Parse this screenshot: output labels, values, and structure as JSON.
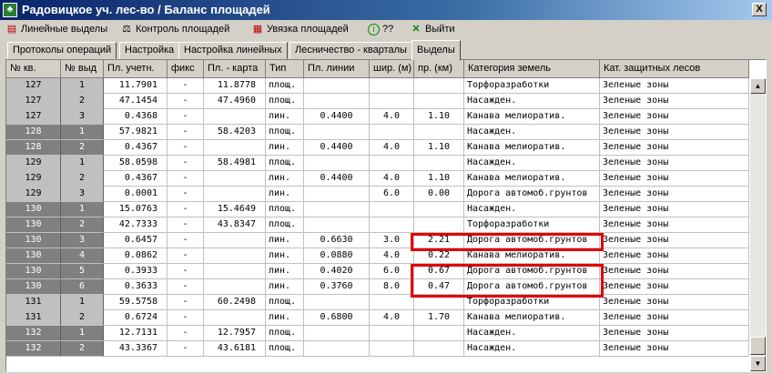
{
  "window": {
    "title": "Радовицкое уч. лес-во / Баланс площадей",
    "close_label": "X"
  },
  "toolbar": {
    "items": [
      {
        "label": "Линейные выделы",
        "icon": "document-icon"
      },
      {
        "label": "Контроль площадей",
        "icon": "scales-icon"
      },
      {
        "label": "Увязка площадей",
        "icon": "calculator-icon"
      },
      {
        "label": "??",
        "icon": "info-icon"
      },
      {
        "label": "Выйти",
        "icon": "exit-x-icon"
      }
    ]
  },
  "tabs": [
    {
      "label": "Протоколы операций",
      "active": false
    },
    {
      "label": "Настройка",
      "active": false
    },
    {
      "label": "Настройка линейных",
      "active": false
    },
    {
      "label": "Лесничество - кварталы",
      "active": false
    },
    {
      "label": "Выделы",
      "active": true
    }
  ],
  "table": {
    "columns": [
      "№ кв.",
      "№ выд",
      "Пл. учетн.",
      "фикс",
      "Пл. - карта",
      "Тип",
      "Пл. линии",
      "шир. (м)",
      "пр. (км)",
      "Категория земель",
      "Кат. защитных лесов"
    ],
    "rows": [
      {
        "kv": "127",
        "vyd": "1",
        "pl": "11.7901",
        "fix": "-",
        "karta": "11.8778",
        "tip": "площ.",
        "lin": "",
        "shir": "",
        "pr": "",
        "kat": "Торфоразработки",
        "zash": "Зеленые зоны"
      },
      {
        "kv": "127",
        "vyd": "2",
        "pl": "47.1454",
        "fix": "-",
        "karta": "47.4960",
        "tip": "площ.",
        "lin": "",
        "shir": "",
        "pr": "",
        "kat": "Насажден.",
        "zash": "Зеленые зоны"
      },
      {
        "kv": "127",
        "vyd": "3",
        "pl": "0.4368",
        "fix": "-",
        "karta": "",
        "tip": "лин.",
        "lin": "0.4400",
        "shir": "4.0",
        "pr": "1.10",
        "kat": "Канава мелиоратив.",
        "zash": "Зеленые зоны"
      },
      {
        "kv": "128",
        "vyd": "1",
        "pl": "57.9821",
        "fix": "-",
        "karta": "58.4203",
        "tip": "площ.",
        "lin": "",
        "shir": "",
        "pr": "",
        "kat": "Насажден.",
        "zash": "Зеленые зоны"
      },
      {
        "kv": "128",
        "vyd": "2",
        "pl": "0.4367",
        "fix": "-",
        "karta": "",
        "tip": "лин.",
        "lin": "0.4400",
        "shir": "4.0",
        "pr": "1.10",
        "kat": "Канава мелиоратив.",
        "zash": "Зеленые зоны"
      },
      {
        "kv": "129",
        "vyd": "1",
        "pl": "58.0598",
        "fix": "-",
        "karta": "58.4981",
        "tip": "площ.",
        "lin": "",
        "shir": "",
        "pr": "",
        "kat": "Насажден.",
        "zash": "Зеленые зоны"
      },
      {
        "kv": "129",
        "vyd": "2",
        "pl": "0.4367",
        "fix": "-",
        "karta": "",
        "tip": "лин.",
        "lin": "0.4400",
        "shir": "4.0",
        "pr": "1.10",
        "kat": "Канава мелиоратив.",
        "zash": "Зеленые зоны"
      },
      {
        "kv": "129",
        "vyd": "3",
        "pl": "0.0001",
        "fix": "-",
        "karta": "",
        "tip": "лин.",
        "lin": "",
        "shir": "6.0",
        "pr": "0.00",
        "kat": "Дорога автомоб.грунтов",
        "zash": "Зеленые зоны"
      },
      {
        "kv": "130",
        "vyd": "1",
        "pl": "15.0763",
        "fix": "-",
        "karta": "15.4649",
        "tip": "площ.",
        "lin": "",
        "shir": "",
        "pr": "",
        "kat": "Насажден.",
        "zash": "Зеленые зоны"
      },
      {
        "kv": "130",
        "vyd": "2",
        "pl": "42.7333",
        "fix": "-",
        "karta": "43.8347",
        "tip": "площ.",
        "lin": "",
        "shir": "",
        "pr": "",
        "kat": "Торфоразработки",
        "zash": "Зеленые зоны"
      },
      {
        "kv": "130",
        "vyd": "3",
        "pl": "0.6457",
        "fix": "-",
        "karta": "",
        "tip": "лин.",
        "lin": "0.6630",
        "shir": "3.0",
        "pr": "2.21",
        "kat": "Дорога автомоб.грунтов",
        "zash": "Зеленые зоны"
      },
      {
        "kv": "130",
        "vyd": "4",
        "pl": "0.0862",
        "fix": "-",
        "karta": "",
        "tip": "лин.",
        "lin": "0.0880",
        "shir": "4.0",
        "pr": "0.22",
        "kat": "Канава мелиоратив.",
        "zash": "Зеленые зоны"
      },
      {
        "kv": "130",
        "vyd": "5",
        "pl": "0.3933",
        "fix": "-",
        "karta": "",
        "tip": "лин.",
        "lin": "0.4020",
        "shir": "6.0",
        "pr": "0.67",
        "kat": "Дорога автомоб.грунтов",
        "zash": "Зеленые зоны"
      },
      {
        "kv": "130",
        "vyd": "6",
        "pl": "0.3633",
        "fix": "-",
        "karta": "",
        "tip": "лин.",
        "lin": "0.3760",
        "shir": "8.0",
        "pr": "0.47",
        "kat": "Дорога автомоб.грунтов",
        "zash": "Зеленые зоны"
      },
      {
        "kv": "131",
        "vyd": "1",
        "pl": "59.5758",
        "fix": "-",
        "karta": "60.2498",
        "tip": "площ.",
        "lin": "",
        "shir": "",
        "pr": "",
        "kat": "Торфоразработки",
        "zash": "Зеленые зоны"
      },
      {
        "kv": "131",
        "vyd": "2",
        "pl": "0.6724",
        "fix": "-",
        "karta": "",
        "tip": "лин.",
        "lin": "0.6800",
        "shir": "4.0",
        "pr": "1.70",
        "kat": "Канава мелиоратив.",
        "zash": "Зеленые зоны"
      },
      {
        "kv": "132",
        "vyd": "1",
        "pl": "12.7131",
        "fix": "-",
        "karta": "12.7957",
        "tip": "площ.",
        "lin": "",
        "shir": "",
        "pr": "",
        "kat": "Насажден.",
        "zash": "Зеленые зоны"
      },
      {
        "kv": "132",
        "vyd": "2",
        "pl": "43.3367",
        "fix": "-",
        "karta": "43.6181",
        "tip": "площ.",
        "lin": "",
        "shir": "",
        "pr": "",
        "kat": "Насажден.",
        "zash": "Зеленые зоны"
      }
    ],
    "highlighted_rows": [
      10,
      12,
      13
    ]
  },
  "colors": {
    "highlight": "#e00000",
    "key_dark": "#808080",
    "key_light": "#c0c0c0"
  }
}
